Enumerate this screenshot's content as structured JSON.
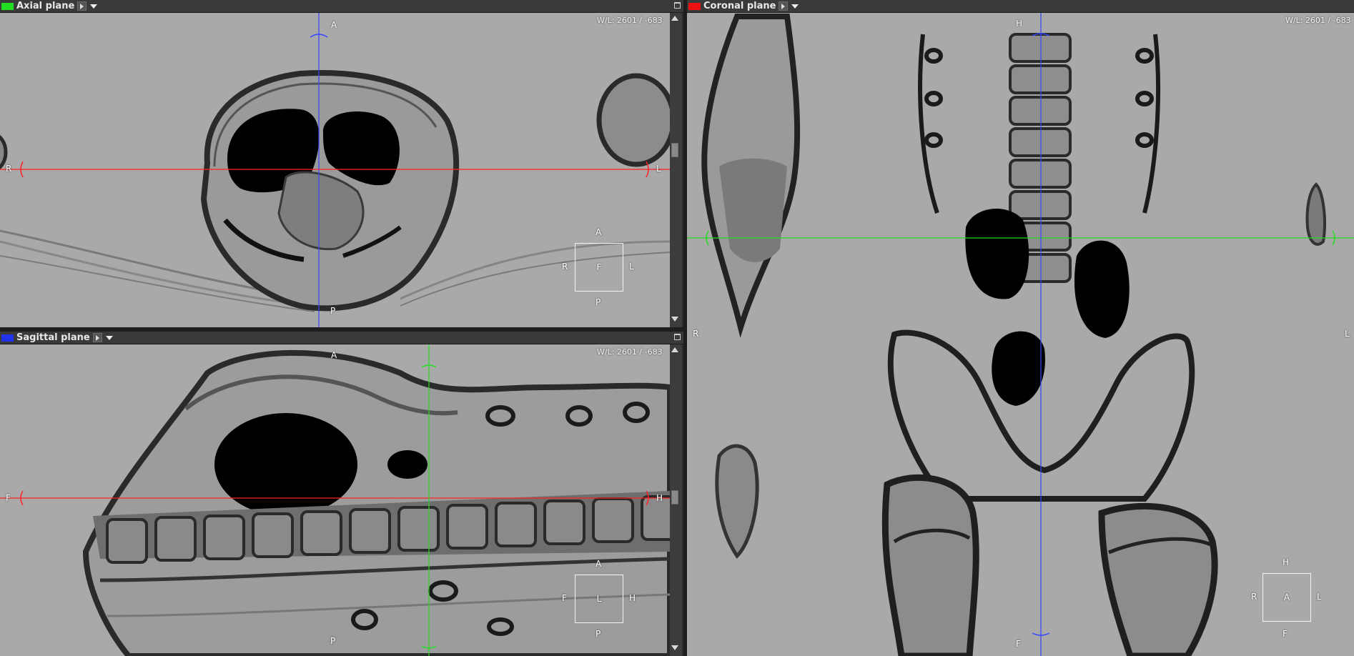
{
  "axial": {
    "title": "Axial plane",
    "color": "#22dd22",
    "wl": "W/L: 2601 / -683",
    "labels": {
      "top": "A",
      "bottom": "P",
      "left": "R",
      "right": "L"
    },
    "orient": {
      "top": "A",
      "bottom": "P",
      "left": "R",
      "right": "L",
      "center": "F"
    }
  },
  "sagittal": {
    "title": "Sagittal plane",
    "color": "#2233ee",
    "wl": "W/L: 2601 / -683",
    "labels": {
      "top": "A",
      "bottom": "P",
      "left": "F",
      "right": "H"
    },
    "orient": {
      "top": "A",
      "bottom": "P",
      "left": "F",
      "right": "H",
      "center": "L"
    }
  },
  "coronal": {
    "title": "Coronal plane",
    "color": "#ee1111",
    "wl": "W/L: 2601 / -683",
    "labels": {
      "top": "H",
      "bottom": "F",
      "left": "R",
      "right": "L"
    },
    "orient": {
      "top": "H",
      "bottom": "F",
      "left": "R",
      "right": "L",
      "center": "A"
    }
  },
  "icons": {
    "play": "triangle-right-icon",
    "menu": "chevron-down-icon",
    "maximize": "maximize-icon"
  },
  "crosshair_colors": {
    "axial": "#22dd22",
    "sagittal": "#3344ff",
    "coronal": "#ff2222"
  }
}
